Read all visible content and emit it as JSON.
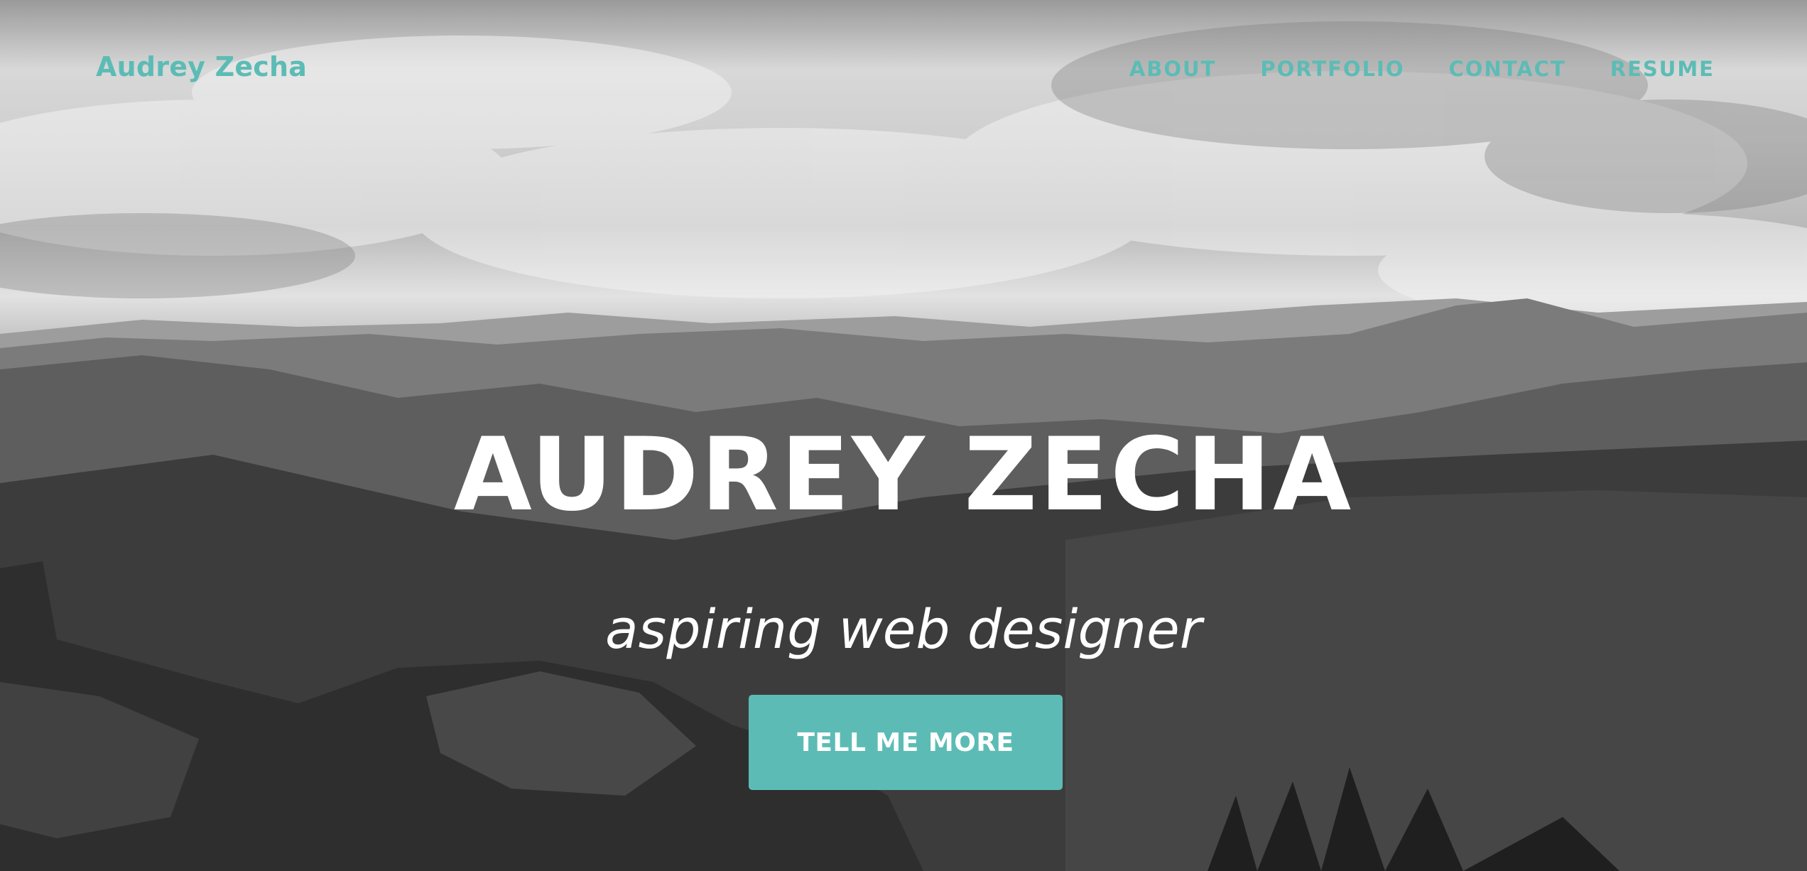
{
  "nav": {
    "brand": "Audrey Zecha",
    "items": [
      {
        "label": "ABOUT"
      },
      {
        "label": "PORTFOLIO"
      },
      {
        "label": "CONTACT"
      },
      {
        "label": "RESUME"
      }
    ]
  },
  "hero": {
    "title": "AUDREY ZECHA",
    "tagline": "aspiring web designer",
    "cta_label": "TELL ME MORE"
  },
  "colors": {
    "accent": "#5cbcb5",
    "headline": "#ffffff"
  }
}
